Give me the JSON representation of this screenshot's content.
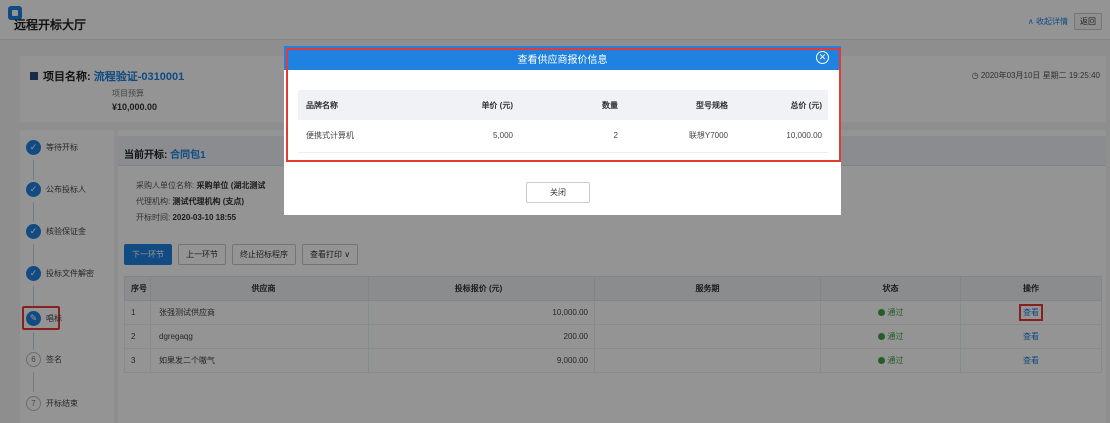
{
  "header": {
    "title": "远程开标大厅",
    "link": "∧ 收起详情",
    "back": "返回"
  },
  "project": {
    "label": "项目名称:",
    "name": "流程验证-0310001",
    "budget_label": "项目预算",
    "budget_value": "¥10,000.00",
    "datetime": "2020年03月10日 星期二 19:25:40"
  },
  "steps": [
    {
      "icon": "check-icon",
      "label": "等待开标"
    },
    {
      "icon": "check-icon",
      "label": "公布投标人"
    },
    {
      "icon": "check-icon",
      "label": "核验保证金"
    },
    {
      "icon": "check-icon",
      "label": "投标文件解密"
    },
    {
      "icon": "edit-icon",
      "label": "唱标"
    },
    {
      "num": "6",
      "label": "签名"
    },
    {
      "num": "7",
      "label": "开标结束"
    }
  ],
  "current": {
    "label": "当前开标:",
    "package": "合同包1",
    "purchaser_label": "采购人单位名称:",
    "purchaser": "采购单位 (湖北测试",
    "agency_label": "代理机构:",
    "agency": "测试代理机构 (支点)",
    "open_time_label": "开标时间:",
    "open_time": "2020-03-10 18:55"
  },
  "toolbar": {
    "next": "下一环节",
    "prev": "上一环节",
    "stop": "终止招标程序",
    "print": "查看打印 ∨"
  },
  "table": {
    "headers": [
      "序号",
      "供应商",
      "投标报价 (元)",
      "服务期",
      "状态",
      "操作"
    ],
    "rows": [
      {
        "no": "1",
        "supplier": "张强测试供应商",
        "price": "10,000.00",
        "service": "",
        "status": "通过",
        "action": "查看"
      },
      {
        "no": "2",
        "supplier": "dgregaqg",
        "price": "200.00",
        "service": "",
        "status": "通过",
        "action": "查看"
      },
      {
        "no": "3",
        "supplier": "如果发二个嗷气",
        "price": "9,000.00",
        "service": "",
        "status": "通过",
        "action": "查看"
      }
    ]
  },
  "modal": {
    "title": "查看供应商报价信息",
    "headers": [
      "品牌名称",
      "单价 (元)",
      "数量",
      "型号规格",
      "总价 (元)"
    ],
    "rows": [
      {
        "brand": "便携式计算机",
        "unit_price": "5,000",
        "qty": "2",
        "model": "联想Y7000",
        "total": "10,000.00"
      }
    ],
    "close_button": "关闭"
  },
  "colors": {
    "accent": "#1f82e0",
    "highlight": "#e53935",
    "status_ok": "#43a047"
  }
}
